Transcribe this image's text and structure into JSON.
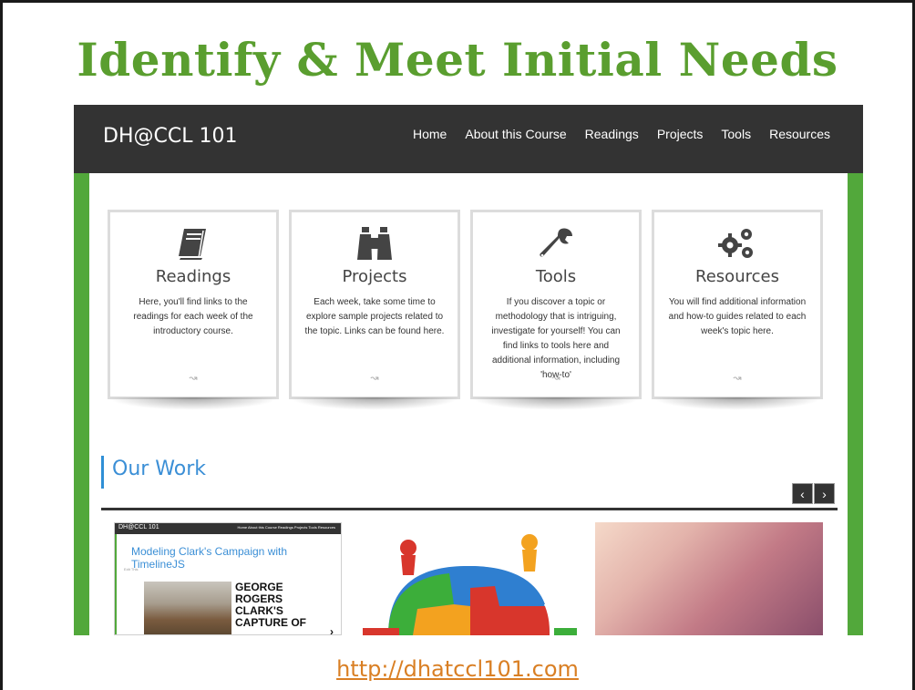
{
  "slide": {
    "title": "Identify & Meet Initial Needs",
    "url": "http://dhatccl101.com",
    "colors": {
      "title": "#5a9e2f",
      "url": "#d97f24",
      "frame_green": "#52a83b",
      "navbar": "#333333",
      "accent_blue": "#3b8fd6"
    }
  },
  "site": {
    "brand": "DH@CCL 101",
    "nav": [
      "Home",
      "About this Course",
      "Readings",
      "Projects",
      "Tools",
      "Resources"
    ],
    "cards": [
      {
        "icon": "book-icon",
        "title": "Readings",
        "text": "Here, you'll find links to the readings for each week of the introductory course.",
        "arrow": "↝"
      },
      {
        "icon": "binoculars-icon",
        "title": "Projects",
        "text": "Each week, take some time to explore sample projects related to the topic. Links can be found here.",
        "arrow": "↝"
      },
      {
        "icon": "wrench-icon",
        "title": "Tools",
        "text": "If you discover a topic or methodology that is intriguing, investigate for yourself! You can find links to tools here and additional information, including 'how-to'",
        "arrow": "↝"
      },
      {
        "icon": "gears-icon",
        "title": "Resources",
        "text": "You will find additional information and how-to guides related to each week's topic here.",
        "arrow": "↝"
      }
    ],
    "our_work": {
      "title": "Our Work",
      "prev": "‹",
      "next": "›",
      "thumb1": {
        "brand": "DH@CCL 101",
        "links": "Home   About this Course   Readings   Projects   Tools   Resources",
        "title": "Modeling Clark's Campaign with TimelineJS",
        "small": "Edit This",
        "headline": "GEORGE ROGERS CLARK'S CAPTURE OF",
        "chevron": "›"
      }
    }
  }
}
